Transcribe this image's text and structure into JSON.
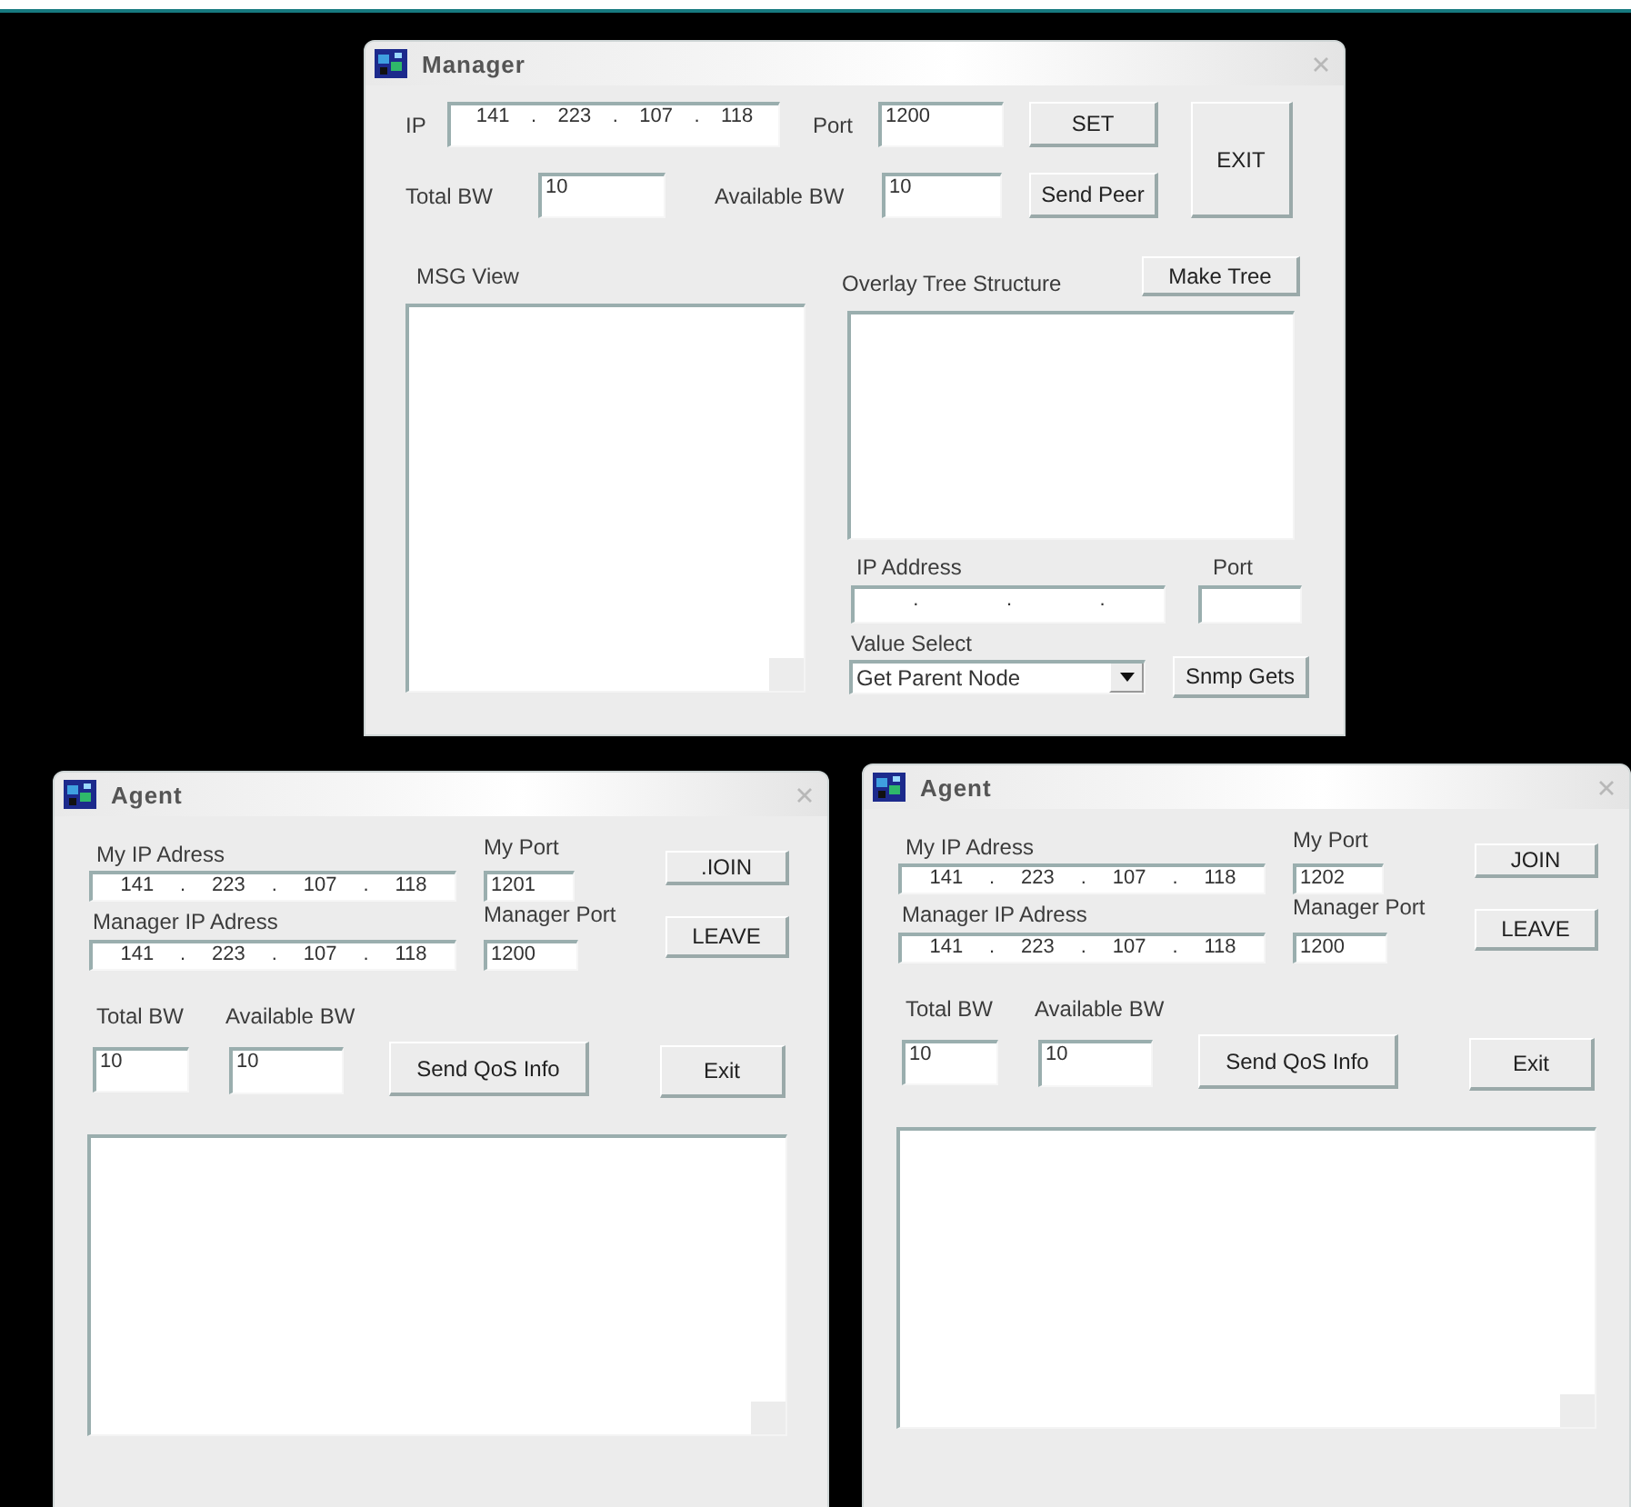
{
  "manager": {
    "title": "Manager",
    "ip_label": "IP",
    "ip": [
      "141",
      ".",
      "223",
      ".",
      "107",
      ".",
      "118"
    ],
    "port_label": "Port",
    "port": "1200",
    "set_button": "SET",
    "exit_button": "EXIT",
    "total_bw_label": "Total BW",
    "total_bw": "10",
    "available_bw_label": "Available BW",
    "available_bw": "10",
    "send_peer_button": "Send Peer",
    "msg_view_label": "MSG View",
    "overlay_label": "Overlay Tree Structure",
    "make_tree_button": "Make Tree",
    "ip_address_label": "IP Address",
    "ip_address": [
      ".",
      ".",
      "."
    ],
    "port_label_2": "Port",
    "value_select_label": "Value Select",
    "value_select": "Get Parent Node",
    "snmp_button": "Snmp Gets"
  },
  "agents": [
    {
      "title": "Agent",
      "my_ip_label": "My IP Adress",
      "my_ip": [
        "141",
        ".",
        "223",
        ".",
        "107",
        ".",
        "118"
      ],
      "my_port_label": "My Port",
      "my_port": "1201",
      "join_button": ".IOIN",
      "manager_ip_label": "Manager IP Adress",
      "manager_ip": [
        "141",
        ".",
        "223",
        ".",
        "107",
        ".",
        "118"
      ],
      "manager_port_label": "Manager Port",
      "manager_port": "1200",
      "leave_button": "LEAVE",
      "total_bw_label": "Total BW",
      "total_bw": "10",
      "available_bw_label": "Available BW",
      "available_bw": "10",
      "send_button": "Send QoS Info",
      "exit_button": "Exit"
    },
    {
      "title": "Agent",
      "my_ip_label": "My IP Adress",
      "my_ip": [
        "141",
        ".",
        "223",
        ".",
        "107",
        ".",
        "118"
      ],
      "my_port_label": "My Port",
      "my_port": "1202",
      "join_button": "JOIN",
      "manager_ip_label": "Manager IP Adress",
      "manager_ip": [
        "141",
        ".",
        "223",
        ".",
        "107",
        ".",
        "118"
      ],
      "manager_port_label": "Manager Port",
      "manager_port": "1200",
      "leave_button": "LEAVE",
      "total_bw_label": "Total BW",
      "total_bw": "10",
      "available_bw_label": "Available BW",
      "available_bw": "10",
      "send_button": "Send QoS Info",
      "exit_button": "Exit"
    }
  ]
}
